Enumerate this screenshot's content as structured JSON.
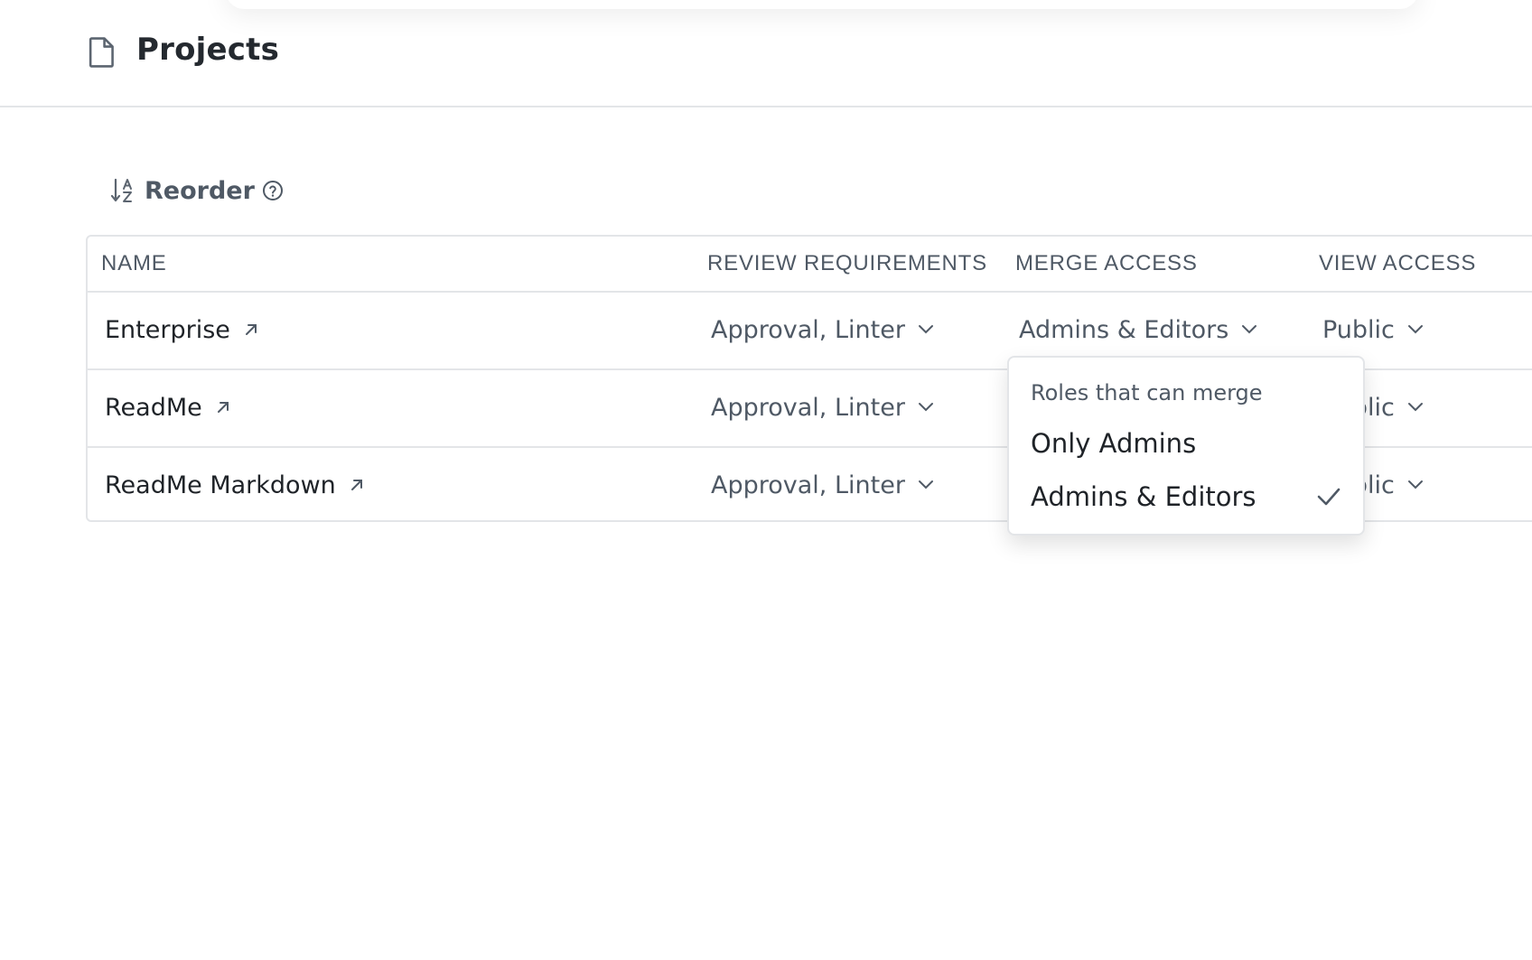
{
  "page": {
    "title": "Projects"
  },
  "toolbar": {
    "reorder_label": "Reorder"
  },
  "table": {
    "headers": [
      "NAME",
      "REVIEW REQUIREMENTS",
      "MERGE ACCESS",
      "VIEW ACCESS"
    ],
    "rows": [
      {
        "name": "Enterprise",
        "review": "Approval, Linter",
        "merge": "Admins & Editors",
        "view": "Public"
      },
      {
        "name": "ReadMe",
        "review": "Approval, Linter",
        "merge": "",
        "view": "Public"
      },
      {
        "name": "ReadMe Markdown",
        "review": "Approval, Linter",
        "merge": "",
        "view": "Public"
      }
    ]
  },
  "merge_dropdown": {
    "title": "Roles that can merge",
    "options": [
      {
        "label": "Only Admins",
        "selected": false
      },
      {
        "label": "Admins & Editors",
        "selected": true
      }
    ]
  },
  "icons": {
    "page": "document-icon",
    "sort": "sort-alpha-icon",
    "help": "help-circle-icon",
    "external": "external-link-icon",
    "chevron": "chevron-down-icon",
    "check": "check-icon"
  },
  "colors": {
    "text": "#1f2328",
    "muted": "#4f5965",
    "border": "#e3e5e8",
    "background": "#ffffff"
  }
}
